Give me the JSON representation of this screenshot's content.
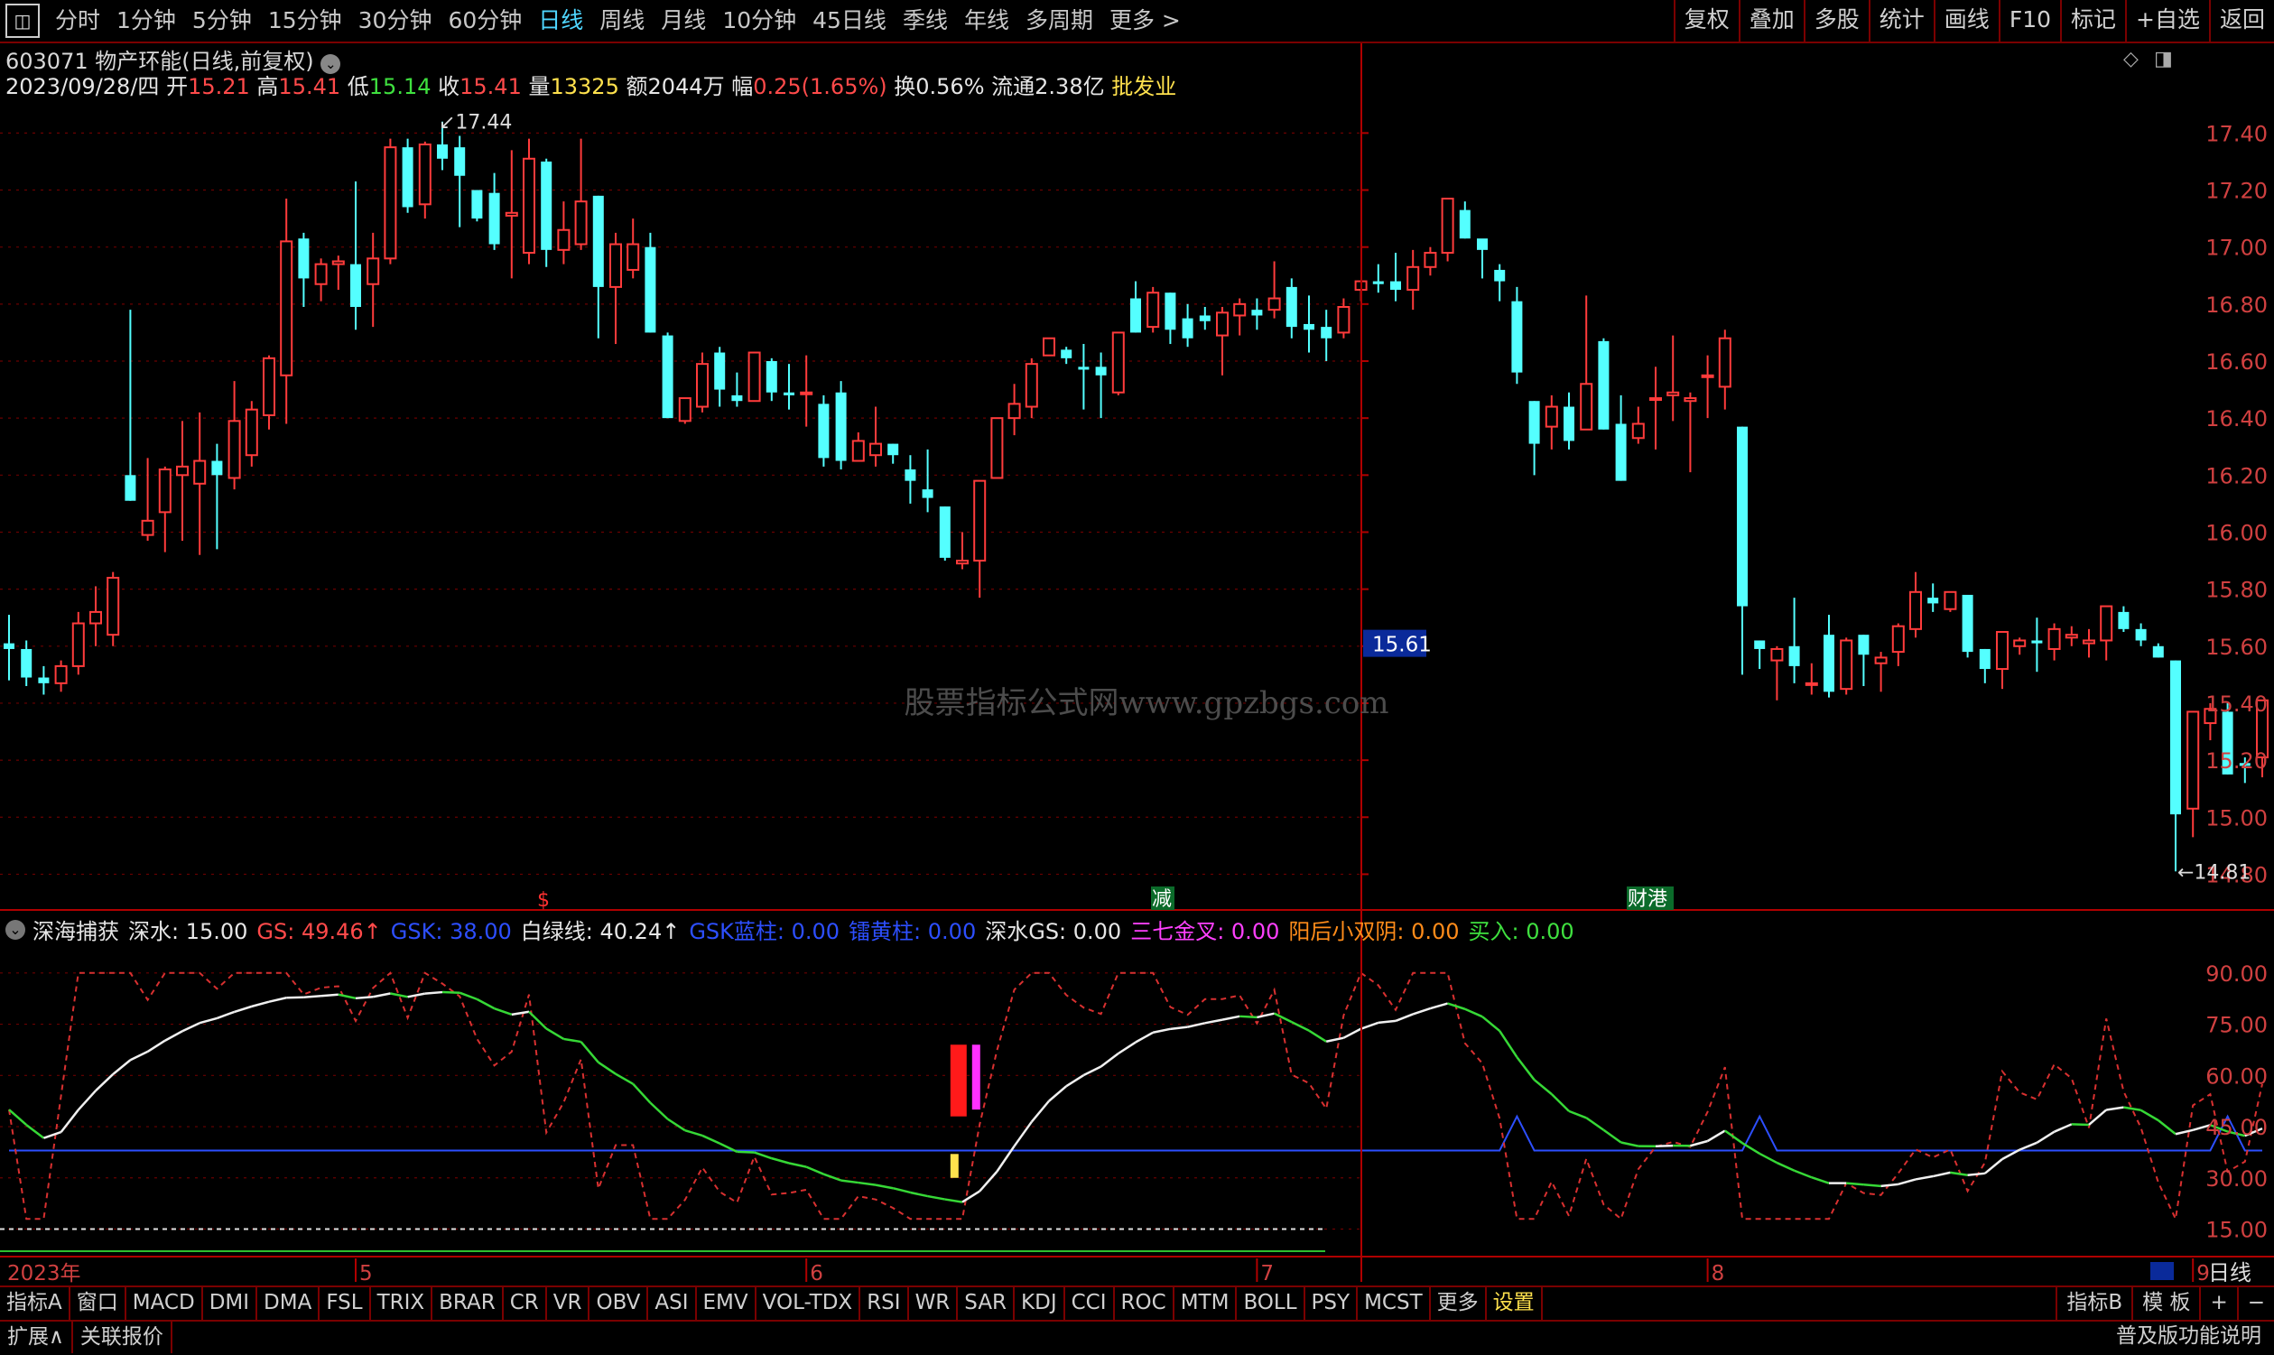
{
  "topbar": {
    "periods": [
      "分时",
      "1分钟",
      "5分钟",
      "15分钟",
      "30分钟",
      "60分钟",
      "日线",
      "周线",
      "月线",
      "10分钟",
      "45日线",
      "季线",
      "年线",
      "多周期",
      "更多 >"
    ],
    "active_period": "日线",
    "tools": [
      "复权",
      "叠加",
      "多股",
      "统计",
      "画线",
      "F10",
      "标记",
      "+自选",
      "返回"
    ]
  },
  "stock": {
    "code": "603071",
    "name": "物产环能",
    "mode": "(日线,前复权)",
    "date": "2023/09/28/四",
    "open_label": "开",
    "open": "15.21",
    "high_label": "高",
    "high": "15.41",
    "low_label": "低",
    "low": "15.14",
    "close_label": "收",
    "close": "15.41",
    "vol_label": "量",
    "vol": "13325",
    "amount_label": "额",
    "amount": "2044万",
    "change_label": "幅",
    "change": "0.25(1.65%)",
    "turnover_label": "换",
    "turnover": "0.56%",
    "float_label": "流通",
    "float": "2.38亿",
    "industry": "批发业"
  },
  "watermark": "股票指标公式网www.gpzbgs.com",
  "price_axis": [
    "17.40",
    "17.20",
    "17.00",
    "16.80",
    "16.60",
    "16.40",
    "16.20",
    "16.00",
    "15.80",
    "15.60",
    "15.40",
    "15.20",
    "15.00",
    "14.80"
  ],
  "current_price_tag": "15.61",
  "annotations": {
    "high": "17.44",
    "low": "14.81",
    "marker_s": "$",
    "marker_jian": "减",
    "marker_caigang": "财港"
  },
  "indicator": {
    "name": "深海捕获",
    "items": [
      {
        "label": "深水: 15.00",
        "color": "#e6e6e6"
      },
      {
        "label": "GS: 49.46↑",
        "color": "#ff4a4a"
      },
      {
        "label": "GSK: 38.00",
        "color": "#2d4fff"
      },
      {
        "label": "白绿线: 40.24↑",
        "color": "#e6e6e6"
      },
      {
        "label": "GSK蓝柱: 0.00",
        "color": "#2d4fff"
      },
      {
        "label": "镭黄柱: 0.00",
        "color": "#2d4fff"
      },
      {
        "label": "深水GS: 0.00",
        "color": "#e6e6e6"
      },
      {
        "label": "三七金叉: 0.00",
        "color": "#ff40ff"
      },
      {
        "label": "阳后小双阴: 0.00",
        "color": "#ff8c1a"
      },
      {
        "label": "买入: 0.00",
        "color": "#3fe03f"
      }
    ],
    "axis": [
      "90.00",
      "75.00",
      "60.00",
      "45.00",
      "30.00",
      "15.00"
    ]
  },
  "date_axis": {
    "year": "2023年",
    "months": [
      "5",
      "6",
      "7",
      "8",
      "9"
    ],
    "period_label": "日线"
  },
  "tabbar": {
    "tabs": [
      "指标A",
      "窗口",
      "MACD",
      "DMI",
      "DMA",
      "FSL",
      "TRIX",
      "BRAR",
      "CR",
      "VR",
      "OBV",
      "ASI",
      "EMV",
      "VOL-TDX",
      "RSI",
      "WR",
      "SAR",
      "KDJ",
      "CCI",
      "ROC",
      "MTM",
      "BOLL",
      "PSY",
      "MCST",
      "更多",
      "设置"
    ],
    "right": [
      "指标B",
      "模 板",
      "+",
      "−"
    ]
  },
  "statusbar": {
    "items": [
      "扩展∧",
      "关联报价"
    ],
    "note": "普及版功能说明"
  },
  "colors": {
    "up": "#ff3b3b",
    "down": "#54ffff",
    "grid": "#7a0000",
    "axis": "#b00000"
  },
  "chart_data": {
    "type": "candlestick",
    "candles": [
      [
        15.61,
        15.71,
        15.48,
        15.59
      ],
      [
        15.59,
        15.62,
        15.46,
        15.49
      ],
      [
        15.49,
        15.53,
        15.43,
        15.47
      ],
      [
        15.47,
        15.55,
        15.44,
        15.53
      ],
      [
        15.53,
        15.72,
        15.5,
        15.68
      ],
      [
        15.68,
        15.81,
        15.6,
        15.72
      ],
      [
        15.64,
        15.86,
        15.6,
        15.84
      ],
      [
        16.2,
        16.78,
        16.11,
        16.11
      ],
      [
        15.99,
        16.26,
        15.97,
        16.04
      ],
      [
        16.07,
        16.23,
        15.93,
        16.22
      ],
      [
        16.2,
        16.39,
        15.97,
        16.23
      ],
      [
        16.17,
        16.42,
        15.92,
        16.25
      ],
      [
        16.25,
        16.31,
        15.94,
        16.2
      ],
      [
        16.19,
        16.53,
        16.15,
        16.39
      ],
      [
        16.27,
        16.46,
        16.23,
        16.43
      ],
      [
        16.41,
        16.62,
        16.36,
        16.61
      ],
      [
        16.55,
        17.17,
        16.38,
        17.02
      ],
      [
        17.03,
        17.05,
        16.79,
        16.89
      ],
      [
        16.87,
        16.96,
        16.81,
        16.94
      ],
      [
        16.94,
        16.97,
        16.85,
        16.95
      ],
      [
        16.94,
        17.23,
        16.71,
        16.79
      ],
      [
        16.87,
        17.05,
        16.72,
        16.96
      ],
      [
        16.96,
        17.38,
        16.94,
        17.35
      ],
      [
        17.35,
        17.38,
        17.12,
        17.14
      ],
      [
        17.15,
        17.37,
        17.1,
        17.36
      ],
      [
        17.36,
        17.44,
        17.27,
        17.31
      ],
      [
        17.35,
        17.39,
        17.07,
        17.25
      ],
      [
        17.2,
        17.2,
        17.09,
        17.1
      ],
      [
        17.19,
        17.26,
        16.99,
        17.01
      ],
      [
        17.11,
        17.34,
        16.89,
        17.12
      ],
      [
        16.98,
        17.38,
        16.94,
        17.31
      ],
      [
        17.3,
        17.31,
        16.93,
        16.99
      ],
      [
        16.99,
        17.16,
        16.94,
        17.06
      ],
      [
        17.01,
        17.38,
        16.99,
        17.16
      ],
      [
        17.18,
        17.18,
        16.68,
        16.86
      ],
      [
        16.86,
        17.05,
        16.66,
        17.01
      ],
      [
        16.92,
        17.1,
        16.89,
        17.01
      ],
      [
        17.0,
        17.05,
        16.7,
        16.7
      ],
      [
        16.69,
        16.7,
        16.4,
        16.4
      ],
      [
        16.39,
        16.47,
        16.38,
        16.47
      ],
      [
        16.44,
        16.63,
        16.42,
        16.59
      ],
      [
        16.63,
        16.65,
        16.44,
        16.5
      ],
      [
        16.48,
        16.56,
        16.44,
        16.46
      ],
      [
        16.46,
        16.63,
        16.46,
        16.63
      ],
      [
        16.6,
        16.61,
        16.46,
        16.49
      ],
      [
        16.49,
        16.59,
        16.43,
        16.48
      ],
      [
        16.49,
        16.62,
        16.37,
        16.49
      ],
      [
        16.45,
        16.48,
        16.23,
        16.26
      ],
      [
        16.49,
        16.53,
        16.22,
        16.25
      ],
      [
        16.25,
        16.35,
        16.25,
        16.32
      ],
      [
        16.27,
        16.44,
        16.23,
        16.31
      ],
      [
        16.31,
        16.31,
        16.24,
        16.27
      ],
      [
        16.22,
        16.27,
        16.1,
        16.18
      ],
      [
        16.15,
        16.29,
        16.07,
        16.12
      ],
      [
        16.09,
        16.09,
        15.9,
        15.91
      ],
      [
        15.89,
        16.0,
        15.87,
        15.9
      ],
      [
        15.9,
        16.18,
        15.77,
        16.18
      ],
      [
        16.19,
        16.4,
        16.19,
        16.4
      ],
      [
        16.4,
        16.52,
        16.34,
        16.45
      ],
      [
        16.44,
        16.61,
        16.4,
        16.59
      ],
      [
        16.62,
        16.68,
        16.62,
        16.68
      ],
      [
        16.64,
        16.65,
        16.59,
        16.61
      ],
      [
        16.58,
        16.66,
        16.43,
        16.57
      ],
      [
        16.58,
        16.63,
        16.4,
        16.55
      ],
      [
        16.49,
        16.7,
        16.48,
        16.7
      ],
      [
        16.82,
        16.88,
        16.7,
        16.7
      ],
      [
        16.72,
        16.86,
        16.7,
        16.84
      ],
      [
        16.84,
        16.84,
        16.66,
        16.71
      ],
      [
        16.75,
        16.8,
        16.65,
        16.68
      ],
      [
        16.76,
        16.79,
        16.71,
        16.74
      ],
      [
        16.69,
        16.79,
        16.55,
        16.77
      ],
      [
        16.76,
        16.82,
        16.69,
        16.8
      ],
      [
        16.78,
        16.82,
        16.71,
        16.76
      ],
      [
        16.78,
        16.95,
        16.75,
        16.82
      ],
      [
        16.86,
        16.89,
        16.68,
        16.72
      ],
      [
        16.73,
        16.83,
        16.63,
        16.71
      ],
      [
        16.72,
        16.78,
        16.6,
        16.68
      ],
      [
        16.7,
        16.82,
        16.68,
        16.79
      ],
      [
        16.85,
        16.88,
        16.81,
        16.88
      ],
      [
        16.88,
        16.94,
        16.84,
        16.87
      ],
      [
        16.88,
        16.98,
        16.81,
        16.85
      ],
      [
        16.85,
        16.99,
        16.78,
        16.93
      ],
      [
        16.93,
        17.0,
        16.9,
        16.98
      ],
      [
        16.98,
        17.17,
        16.95,
        17.17
      ],
      [
        17.13,
        17.16,
        17.03,
        17.03
      ],
      [
        17.03,
        17.01,
        16.89,
        16.99
      ],
      [
        16.92,
        16.94,
        16.81,
        16.88
      ],
      [
        16.81,
        16.86,
        16.52,
        16.56
      ],
      [
        16.46,
        16.46,
        16.2,
        16.31
      ],
      [
        16.37,
        16.48,
        16.29,
        16.44
      ],
      [
        16.44,
        16.49,
        16.29,
        16.32
      ],
      [
        16.36,
        16.83,
        16.36,
        16.52
      ],
      [
        16.67,
        16.68,
        16.36,
        16.36
      ],
      [
        16.38,
        16.48,
        16.18,
        16.18
      ],
      [
        16.33,
        16.44,
        16.31,
        16.38
      ],
      [
        16.47,
        16.58,
        16.29,
        16.47
      ],
      [
        16.48,
        16.69,
        16.39,
        16.49
      ],
      [
        16.46,
        16.49,
        16.21,
        16.47
      ],
      [
        16.55,
        16.62,
        16.4,
        16.55
      ],
      [
        16.51,
        16.71,
        16.43,
        16.68
      ],
      [
        16.37,
        16.37,
        15.5,
        15.74
      ],
      [
        15.62,
        15.62,
        15.52,
        15.59
      ],
      [
        15.55,
        15.6,
        15.41,
        15.59
      ],
      [
        15.6,
        15.77,
        15.47,
        15.53
      ],
      [
        15.47,
        15.54,
        15.43,
        15.47
      ],
      [
        15.64,
        15.71,
        15.42,
        15.44
      ],
      [
        15.45,
        15.63,
        15.43,
        15.62
      ],
      [
        15.64,
        15.64,
        15.46,
        15.57
      ],
      [
        15.54,
        15.58,
        15.44,
        15.56
      ],
      [
        15.58,
        15.68,
        15.53,
        15.67
      ],
      [
        15.66,
        15.86,
        15.63,
        15.79
      ],
      [
        15.77,
        15.82,
        15.72,
        15.75
      ],
      [
        15.73,
        15.79,
        15.72,
        15.79
      ],
      [
        15.78,
        15.78,
        15.56,
        15.58
      ],
      [
        15.59,
        15.59,
        15.47,
        15.52
      ],
      [
        15.52,
        15.65,
        15.45,
        15.65
      ],
      [
        15.6,
        15.63,
        15.57,
        15.62
      ],
      [
        15.62,
        15.7,
        15.51,
        15.61
      ],
      [
        15.59,
        15.68,
        15.55,
        15.66
      ],
      [
        15.63,
        15.67,
        15.6,
        15.64
      ],
      [
        15.61,
        15.66,
        15.56,
        15.62
      ],
      [
        15.62,
        15.74,
        15.55,
        15.74
      ],
      [
        15.72,
        15.74,
        15.65,
        15.66
      ],
      [
        15.66,
        15.68,
        15.6,
        15.62
      ],
      [
        15.6,
        15.61,
        15.56,
        15.56
      ],
      [
        15.55,
        15.55,
        14.81,
        15.01
      ],
      [
        15.03,
        15.37,
        14.93,
        15.37
      ],
      [
        15.33,
        15.4,
        15.27,
        15.38
      ],
      [
        15.37,
        15.4,
        15.15,
        15.15
      ],
      [
        15.19,
        15.21,
        15.12,
        15.18
      ],
      [
        15.21,
        15.41,
        15.14,
        15.41
      ]
    ],
    "sub_chart_series": [
      "深水",
      "GS",
      "GSK",
      "白绿线"
    ],
    "sub_ylim": [
      8,
      100
    ],
    "ylim": [
      14.7,
      17.55
    ]
  }
}
